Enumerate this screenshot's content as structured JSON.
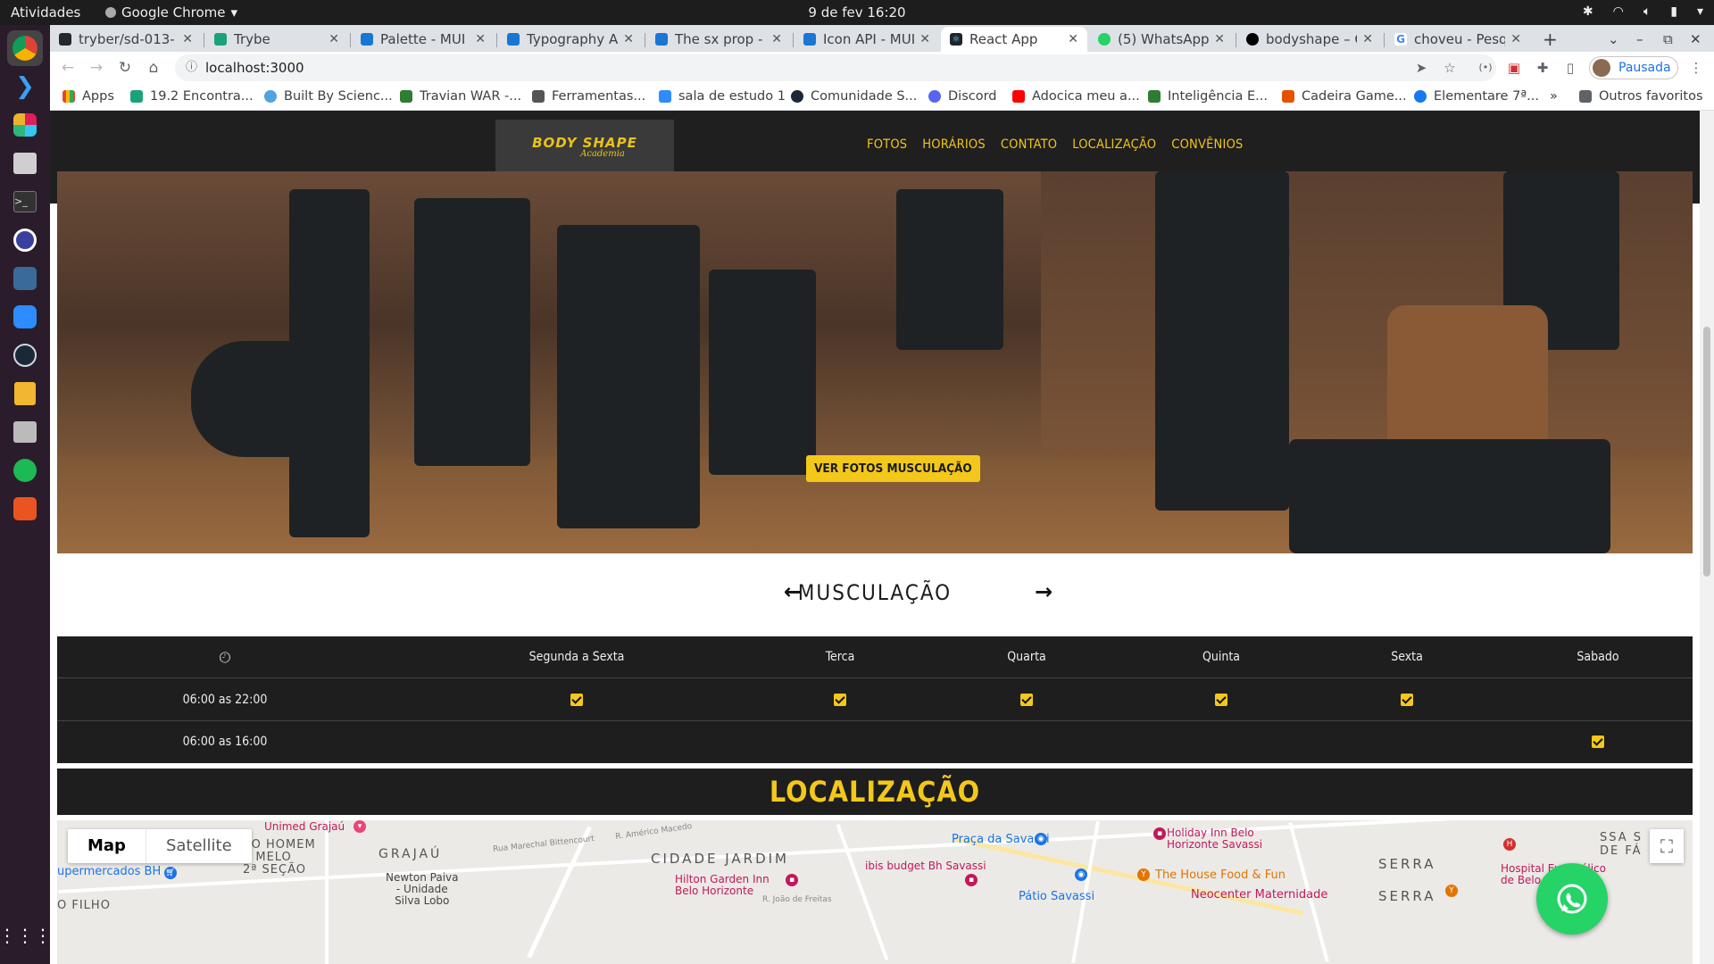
{
  "system": {
    "activities": "Atividades",
    "app_name": "Google Chrome",
    "clock": "9 de fev  16:20"
  },
  "browser": {
    "tabs": [
      {
        "title": "tryber/sd-013-",
        "color": "#24292e"
      },
      {
        "title": "Trybe",
        "color": "#1aa37a"
      },
      {
        "title": "Palette - MUI",
        "color": "#1976d2"
      },
      {
        "title": "Typography AF",
        "color": "#1976d2"
      },
      {
        "title": "The sx prop - M",
        "color": "#1976d2"
      },
      {
        "title": "Icon API - MUI",
        "color": "#1976d2"
      },
      {
        "title": "React App",
        "color": "#20232a"
      },
      {
        "title": "(5) WhatsApp",
        "color": "#25d366"
      },
      {
        "title": "bodyshape – C",
        "color": "#000000"
      },
      {
        "title": "choveu - Pesqu",
        "color": "#4285f4"
      }
    ],
    "new_tab": "+",
    "url": "localhost:3000",
    "profile_label": "Pausada",
    "bookmarks": [
      "Apps",
      "19.2 Encontra...",
      "Built By Scienc...",
      "Travian WAR -...",
      "Ferramentas...",
      "sala de estudo 1",
      "Comunidade S...",
      "Discord",
      "Adocica meu a...",
      "Inteligência E...",
      "Cadeira Game...",
      "Elementare 7ª..."
    ],
    "bookmarks_more": "»",
    "other_bookmarks": "Outros favoritos"
  },
  "site": {
    "logo_line1": "BODY SHAPE",
    "logo_line2": "Academia",
    "nav": [
      "FOTOS",
      "HORÁRIOS",
      "CONTATO",
      "LOCALIZAÇÃO",
      "CONVÊNIOS"
    ],
    "hero_button": "VER FOTOS MUSCULAÇÃO",
    "selector_title": "MUSCULAÇÃO",
    "schedule": {
      "days": [
        "Segunda a Sexta",
        "Terca",
        "Quarta",
        "Quinta",
        "Sexta",
        "Sabado"
      ],
      "rows": [
        {
          "time": "06:00 as 22:00",
          "checks": [
            true,
            true,
            true,
            true,
            true,
            false
          ]
        },
        {
          "time": "06:00 as 16:00",
          "checks": [
            false,
            false,
            false,
            false,
            false,
            true
          ]
        }
      ]
    },
    "location_title": "LOCALIZAÇÃO"
  },
  "map": {
    "map_button": "Map",
    "satellite_button": "Satellite",
    "labels": {
      "unimed": "Unimed Grajaú",
      "homem": "ÃO HOMEM",
      "melo": "E MELO",
      "secao": "2ª SEÇÃO",
      "grajau": "GRAJAÚ",
      "supermercados": "upermercados BH",
      "newton": "Newton Paiva\n- Unidade\nSilva Lobo",
      "filho": "O FILHO",
      "marechal": "Rua Marechal Bittencourt",
      "americo": "R. Américo Macedo",
      "cidade_jardim": "CIDADE JARDIM",
      "ibis": "ibis budget Bh Savassi",
      "hilton": "Hilton Garden Inn\nBelo Horizonte",
      "joao": "R. João de Freitas",
      "praca": "Praça da Savassi",
      "patio": "Pátio Savassi",
      "holiday": "Holiday Inn Belo\nHorizonte Savassi",
      "house_food": "The House Food & Fun",
      "neocenter": "Neocenter Maternidade",
      "serra": "SERRA",
      "serra2": "SERRA",
      "hospital": "Hospital Evangélico\nde Belo Horizonte",
      "savassi_cut": "SSA S\nDE FÁ"
    }
  }
}
